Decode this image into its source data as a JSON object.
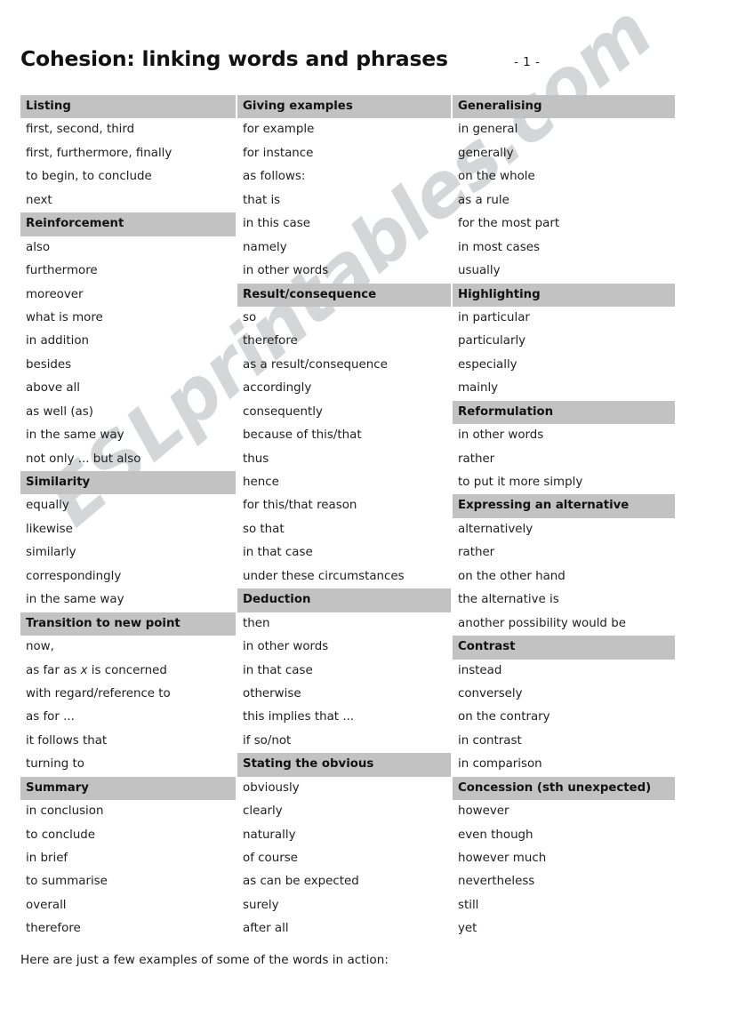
{
  "header": {
    "title": "Cohesion: linking words and phrases",
    "page_number": "- 1 -"
  },
  "watermark": {
    "text": "ESLprintables.com"
  },
  "footer": {
    "note": "Here are just a few examples of some of the words in action:"
  },
  "colors": {
    "category_bar": "#c2c2c2",
    "page_background": "#ffffff",
    "text": "#1a1a1a"
  },
  "columns": [
    {
      "index": 0,
      "rows": [
        {
          "type": "category",
          "label": "Listing"
        },
        {
          "type": "item",
          "label": "first, second, third"
        },
        {
          "type": "item",
          "label": "first, furthermore, finally"
        },
        {
          "type": "item",
          "label": "to begin, to conclude"
        },
        {
          "type": "item",
          "label": "next"
        },
        {
          "type": "category",
          "label": "Reinforcement"
        },
        {
          "type": "item",
          "label": "also"
        },
        {
          "type": "item",
          "label": "furthermore"
        },
        {
          "type": "item",
          "label": "moreover"
        },
        {
          "type": "item",
          "label": "what is more"
        },
        {
          "type": "item",
          "label": "in addition"
        },
        {
          "type": "item",
          "label": "besides"
        },
        {
          "type": "item",
          "label": "above all"
        },
        {
          "type": "item",
          "label": "as well (as)"
        },
        {
          "type": "item",
          "label": "in the same way"
        },
        {
          "type": "item",
          "label": "not only ... but also"
        },
        {
          "type": "category",
          "label": "Similarity"
        },
        {
          "type": "item",
          "label": "equally"
        },
        {
          "type": "item",
          "label": "likewise"
        },
        {
          "type": "item",
          "label": "similarly"
        },
        {
          "type": "item",
          "label": "correspondingly"
        },
        {
          "type": "item",
          "label": "in the same way"
        },
        {
          "type": "category",
          "label": "Transition to new point"
        },
        {
          "type": "item",
          "label": "now,"
        },
        {
          "type": "item",
          "label": "as far as x is concerned",
          "italic_part": "x"
        },
        {
          "type": "item",
          "label": "with regard/reference to"
        },
        {
          "type": "item",
          "label": "as for ..."
        },
        {
          "type": "item",
          "label": "it follows that"
        },
        {
          "type": "item",
          "label": "turning to"
        },
        {
          "type": "category",
          "label": "Summary"
        },
        {
          "type": "item",
          "label": "in conclusion"
        },
        {
          "type": "item",
          "label": "to conclude"
        },
        {
          "type": "item",
          "label": "in brief"
        },
        {
          "type": "item",
          "label": "to summarise"
        },
        {
          "type": "item",
          "label": "overall"
        },
        {
          "type": "item",
          "label": "therefore"
        }
      ]
    },
    {
      "index": 1,
      "rows": [
        {
          "type": "category",
          "label": "Giving examples"
        },
        {
          "type": "item",
          "label": "for example"
        },
        {
          "type": "item",
          "label": "for instance"
        },
        {
          "type": "item",
          "label": "as follows:"
        },
        {
          "type": "item",
          "label": "that is"
        },
        {
          "type": "item",
          "label": "in this case"
        },
        {
          "type": "item",
          "label": "namely"
        },
        {
          "type": "item",
          "label": "in other words"
        },
        {
          "type": "category",
          "label": "Result/consequence"
        },
        {
          "type": "item",
          "label": "so"
        },
        {
          "type": "item",
          "label": "therefore"
        },
        {
          "type": "item",
          "label": "as a result/consequence"
        },
        {
          "type": "item",
          "label": "accordingly"
        },
        {
          "type": "item",
          "label": "consequently"
        },
        {
          "type": "item",
          "label": "because of this/that"
        },
        {
          "type": "item",
          "label": "thus"
        },
        {
          "type": "item",
          "label": "hence"
        },
        {
          "type": "item",
          "label": "for this/that reason"
        },
        {
          "type": "item",
          "label": "so that"
        },
        {
          "type": "item",
          "label": "in that case"
        },
        {
          "type": "item",
          "label": "under these circumstances"
        },
        {
          "type": "category",
          "label": "Deduction"
        },
        {
          "type": "item",
          "label": "then"
        },
        {
          "type": "item",
          "label": "in other words"
        },
        {
          "type": "item",
          "label": "in that case"
        },
        {
          "type": "item",
          "label": "otherwise"
        },
        {
          "type": "item",
          "label": "this implies that ..."
        },
        {
          "type": "item",
          "label": "if so/not"
        },
        {
          "type": "category",
          "label": "Stating the obvious"
        },
        {
          "type": "item",
          "label": "obviously"
        },
        {
          "type": "item",
          "label": "clearly"
        },
        {
          "type": "item",
          "label": "naturally"
        },
        {
          "type": "item",
          "label": "of course"
        },
        {
          "type": "item",
          "label": "as can be expected"
        },
        {
          "type": "item",
          "label": "surely"
        },
        {
          "type": "item",
          "label": "after all"
        }
      ]
    },
    {
      "index": 2,
      "rows": [
        {
          "type": "category",
          "label": "Generalising"
        },
        {
          "type": "item",
          "label": "in general"
        },
        {
          "type": "item",
          "label": "generally"
        },
        {
          "type": "item",
          "label": "on the whole"
        },
        {
          "type": "item",
          "label": "as a rule"
        },
        {
          "type": "item",
          "label": "for the most part"
        },
        {
          "type": "item",
          "label": "in most cases"
        },
        {
          "type": "item",
          "label": "usually"
        },
        {
          "type": "category",
          "label": "Highlighting"
        },
        {
          "type": "item",
          "label": "in particular"
        },
        {
          "type": "item",
          "label": "particularly"
        },
        {
          "type": "item",
          "label": "especially"
        },
        {
          "type": "item",
          "label": "mainly"
        },
        {
          "type": "category",
          "label": "Reformulation"
        },
        {
          "type": "item",
          "label": "in other words"
        },
        {
          "type": "item",
          "label": "rather"
        },
        {
          "type": "item",
          "label": "to put it more simply"
        },
        {
          "type": "category",
          "label": "Expressing an alternative"
        },
        {
          "type": "item",
          "label": "alternatively"
        },
        {
          "type": "item",
          "label": "rather"
        },
        {
          "type": "item",
          "label": "on the other hand"
        },
        {
          "type": "item",
          "label": "the alternative is"
        },
        {
          "type": "item",
          "label": "another possibility would be"
        },
        {
          "type": "category",
          "label": "Contrast"
        },
        {
          "type": "item",
          "label": "instead"
        },
        {
          "type": "item",
          "label": "conversely"
        },
        {
          "type": "item",
          "label": "on the contrary"
        },
        {
          "type": "item",
          "label": "in contrast"
        },
        {
          "type": "item",
          "label": "in comparison"
        },
        {
          "type": "category",
          "label": "Concession (sth unexpected)"
        },
        {
          "type": "item",
          "label": "however"
        },
        {
          "type": "item",
          "label": "even though"
        },
        {
          "type": "item",
          "label": "however much"
        },
        {
          "type": "item",
          "label": "nevertheless"
        },
        {
          "type": "item",
          "label": "still"
        },
        {
          "type": "item",
          "label": "yet"
        }
      ]
    }
  ]
}
